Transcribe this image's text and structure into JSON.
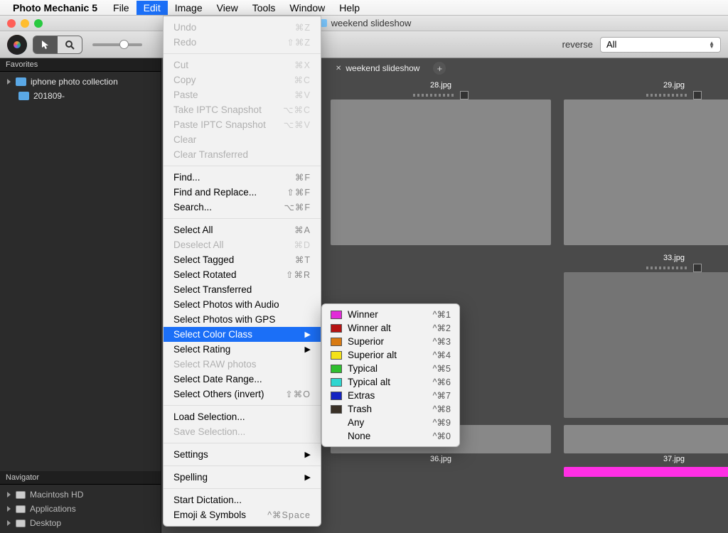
{
  "menubar": {
    "appname": "Photo Mechanic 5",
    "items": [
      "File",
      "Edit",
      "Image",
      "View",
      "Tools",
      "Window",
      "Help"
    ],
    "active_index": 1
  },
  "window": {
    "title": "weekend slideshow"
  },
  "toolbar": {
    "reverse_label": "reverse",
    "sort_value": "All"
  },
  "tabs": [
    {
      "label": "weekend slideshow",
      "active": true
    }
  ],
  "favorites": {
    "header": "Favorites",
    "items": [
      {
        "label": "iphone photo collection"
      },
      {
        "label": "201809-"
      }
    ]
  },
  "navigator": {
    "header": "Navigator",
    "items": [
      {
        "label": "Macintosh HD"
      },
      {
        "label": "Applications"
      },
      {
        "label": "Desktop"
      }
    ]
  },
  "thumbs": {
    "row1": [
      "28.jpg",
      "29.jpg"
    ],
    "row2": [
      "33.jpg"
    ],
    "row3": [
      "36.jpg",
      "37.jpg"
    ]
  },
  "edit_menu": [
    {
      "label": "Undo",
      "sc": "⌘Z",
      "disabled": true
    },
    {
      "label": "Redo",
      "sc": "⇧⌘Z",
      "disabled": true
    },
    {
      "separator": true
    },
    {
      "label": "Cut",
      "sc": "⌘X",
      "disabled": true
    },
    {
      "label": "Copy",
      "sc": "⌘C",
      "disabled": true
    },
    {
      "label": "Paste",
      "sc": "⌘V",
      "disabled": true
    },
    {
      "label": "Take IPTC Snapshot",
      "sc": "⌥⌘C",
      "disabled": true
    },
    {
      "label": "Paste IPTC Snapshot",
      "sc": "⌥⌘V",
      "disabled": true
    },
    {
      "label": "Clear",
      "disabled": true
    },
    {
      "label": "Clear Transferred",
      "disabled": true
    },
    {
      "separator": true
    },
    {
      "label": "Find...",
      "sc": "⌘F"
    },
    {
      "label": "Find and Replace...",
      "sc": "⇧⌘F"
    },
    {
      "label": "Search...",
      "sc": "⌥⌘F"
    },
    {
      "separator": true
    },
    {
      "label": "Select All",
      "sc": "⌘A"
    },
    {
      "label": "Deselect All",
      "sc": "⌘D",
      "disabled": true
    },
    {
      "label": "Select Tagged",
      "sc": "⌘T"
    },
    {
      "label": "Select Rotated",
      "sc": "⇧⌘R"
    },
    {
      "label": "Select Transferred"
    },
    {
      "label": "Select Photos with Audio"
    },
    {
      "label": "Select Photos with GPS"
    },
    {
      "label": "Select Color Class",
      "submenu": true,
      "highlight": true
    },
    {
      "label": "Select Rating",
      "submenu": true
    },
    {
      "label": "Select RAW photos",
      "disabled": true
    },
    {
      "label": "Select Date Range..."
    },
    {
      "label": "Select Others (invert)",
      "sc": "⇧⌘O"
    },
    {
      "separator": true
    },
    {
      "label": "Load Selection..."
    },
    {
      "label": "Save Selection...",
      "disabled": true
    },
    {
      "separator": true
    },
    {
      "label": "Settings",
      "submenu": true
    },
    {
      "separator": true
    },
    {
      "label": "Spelling",
      "submenu": true
    },
    {
      "separator": true
    },
    {
      "label": "Start Dictation..."
    },
    {
      "label": "Emoji & Symbols",
      "sc": "^⌘Space"
    }
  ],
  "color_submenu": [
    {
      "color": "#e22bd8",
      "label": "Winner",
      "sc": "^⌘1"
    },
    {
      "color": "#b51212",
      "label": "Winner alt",
      "sc": "^⌘2"
    },
    {
      "color": "#d87a12",
      "label": "Superior",
      "sc": "^⌘3"
    },
    {
      "color": "#f4e21a",
      "label": "Superior alt",
      "sc": "^⌘4"
    },
    {
      "color": "#2fbf2f",
      "label": "Typical",
      "sc": "^⌘5"
    },
    {
      "color": "#2fd6d0",
      "label": "Typical alt",
      "sc": "^⌘6"
    },
    {
      "color": "#1524c2",
      "label": "Extras",
      "sc": "^⌘7"
    },
    {
      "color": "#3a3127",
      "label": "Trash",
      "sc": "^⌘8"
    },
    {
      "label": "Any",
      "sc": "^⌘9"
    },
    {
      "label": "None",
      "sc": "^⌘0"
    }
  ]
}
